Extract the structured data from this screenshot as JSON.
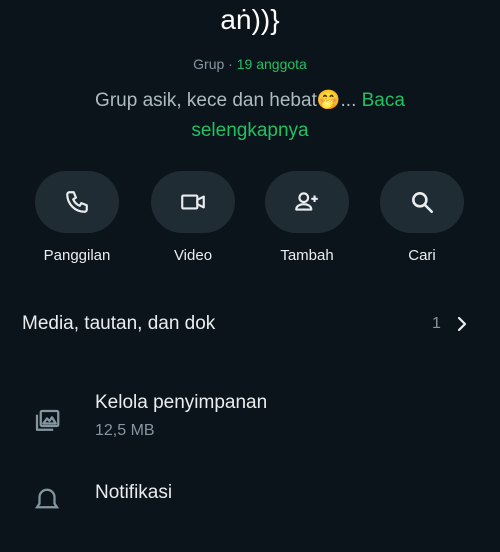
{
  "group": {
    "name": "aṅ))}",
    "type_label": "Grup · ",
    "members": "19 anggota",
    "description": "Grup asik, kece dan hebat🤭... ",
    "read_more": "Baca selengkapnya"
  },
  "actions": [
    {
      "label": "Panggilan",
      "icon": "phone-icon"
    },
    {
      "label": "Video",
      "icon": "video-icon"
    },
    {
      "label": "Tambah",
      "icon": "add-person-icon"
    },
    {
      "label": "Cari",
      "icon": "search-icon"
    }
  ],
  "media": {
    "label": "Media, tautan, dan dok",
    "count": "1"
  },
  "storage": {
    "label": "Kelola penyimpanan",
    "size": "12,5 MB"
  },
  "notifications": {
    "label": "Notifikasi"
  },
  "colors": {
    "background": "#0b141a",
    "accent": "#21c063",
    "button_bg": "#1f2c34",
    "secondary_text": "#8696a0"
  }
}
